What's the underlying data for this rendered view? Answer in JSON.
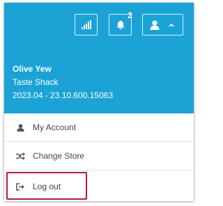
{
  "header": {
    "background_color": "#1ba3d6",
    "notifications_count": "2",
    "icons": {
      "stats": "signal-bars-icon",
      "notifications": "bell-icon",
      "user": "user-icon",
      "expand": "chevron-up-icon"
    }
  },
  "user": {
    "name": "Olive Yew",
    "store": "Taste Shack",
    "version": "2023.04 - 23.10.600.15063"
  },
  "menu": {
    "items": [
      {
        "label": "My Account",
        "icon": "user-icon"
      },
      {
        "label": "Change Store",
        "icon": "shuffle-icon"
      },
      {
        "label": "Log out",
        "icon": "sign-out-icon"
      }
    ]
  },
  "highlight_color": "#b01e3a"
}
